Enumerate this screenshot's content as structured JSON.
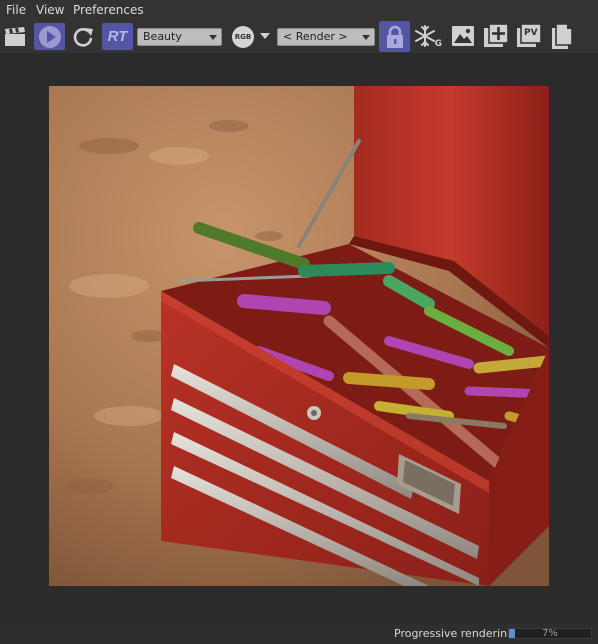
{
  "menu": {
    "file": "File",
    "view": "View",
    "preferences": "Preferences"
  },
  "toolbar": {
    "rt_label": "RT",
    "aov_value": "Beauty",
    "rgb_label": "RGB",
    "camera_value": "< Render >",
    "g_label": "G",
    "pv_label": "PV",
    "icons": [
      "clapperboard-icon",
      "play-icon",
      "refresh-icon",
      "lock-icon",
      "snowflake-icon",
      "image-icon",
      "add-image-icon",
      "pv-icon",
      "copy-icon"
    ]
  },
  "status": {
    "text": "Progressive rendering",
    "progress_label": "7%",
    "progress_fraction": 0.07
  },
  "colors": {
    "accent": "#5555a6",
    "progress": "#5b8fd0",
    "background": "#2b2b2b"
  }
}
